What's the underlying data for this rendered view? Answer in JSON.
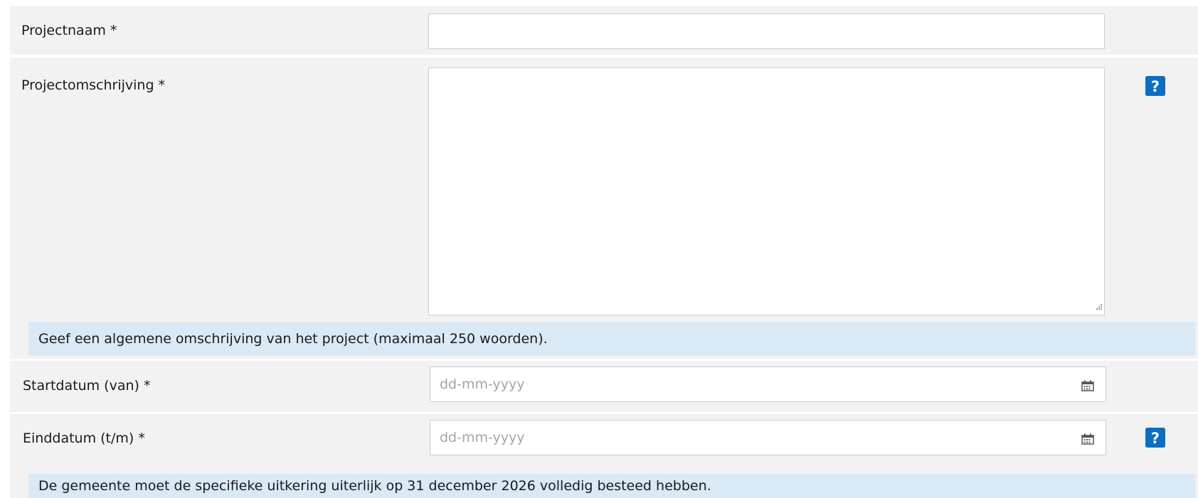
{
  "fields": {
    "project_name": {
      "label": "Projectnaam *",
      "value": ""
    },
    "project_description": {
      "label": "Projectomschrijving *",
      "value": "",
      "hint": "Geef een algemene omschrijving van het project (maximaal 250 woorden)."
    },
    "start_date": {
      "label": "Startdatum (van) *",
      "placeholder": "dd-mm-yyyy"
    },
    "end_date": {
      "label": "Einddatum (t/m) *",
      "placeholder": "dd-mm-yyyy",
      "hint": "De gemeente moet de specifieke uitkering uiterlijk op 31 december 2026 volledig besteed hebben."
    }
  },
  "icons": {
    "help": "help-icon",
    "calendar": "calendar-icon",
    "resize": "resize-grip-icon"
  },
  "colors": {
    "row_background": "#f2f2f2",
    "hint_background": "#d9e9f6",
    "help_icon": "#0a6fc2",
    "placeholder_text": "#a5a5a5",
    "input_border": "#cccccc"
  }
}
